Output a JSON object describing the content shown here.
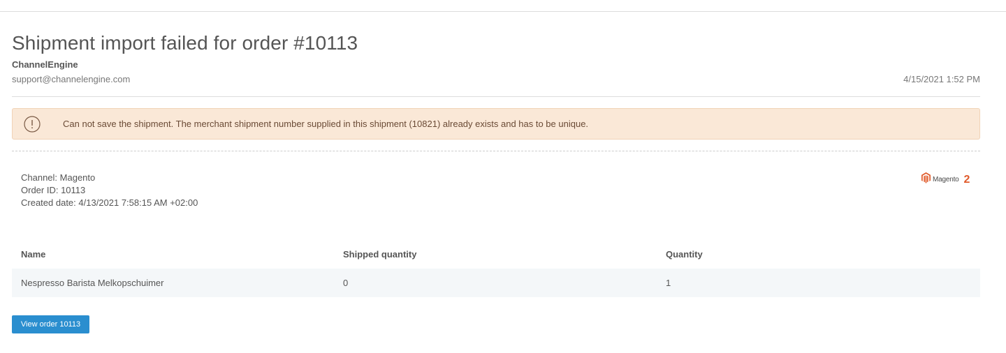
{
  "header": {
    "title": "Shipment import failed for order #10113",
    "sender_name": "ChannelEngine",
    "sender_email": "support@channelengine.com",
    "date": "4/15/2021 1:52 PM"
  },
  "alert": {
    "icon": "exclamation-circle-icon",
    "message": "Can not save the shipment. The merchant shipment number supplied in this shipment (10821) already exists and has to be unique."
  },
  "info": {
    "channel": "Channel: Magento",
    "order_id": "Order ID: 10113",
    "created_date": "Created date: 4/13/2021 7:58:15 AM +02:00"
  },
  "logo": {
    "icon": "magento-logo-icon",
    "word": "Magento",
    "version": "2"
  },
  "table": {
    "headers": [
      "Name",
      "Shipped quantity",
      "Quantity"
    ],
    "rows": [
      [
        "Nespresso Barista Melkopschuimer",
        "0",
        "1"
      ]
    ]
  },
  "actions": {
    "view_order_label": "View order 10113"
  },
  "colors": {
    "alert_bg": "#fae8d7",
    "button_bg": "#2a8ecf",
    "logo_accent": "#e05a2a"
  }
}
